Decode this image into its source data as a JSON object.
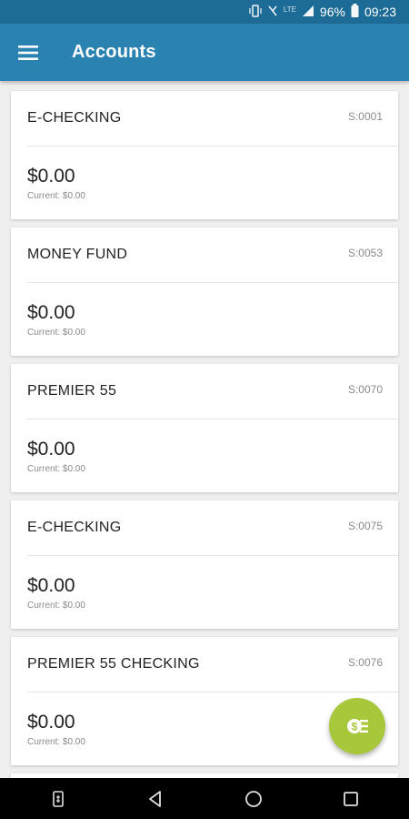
{
  "status_bar": {
    "battery": "96%",
    "time": "09:23",
    "network_label": "LTE",
    "icons": [
      "vibrate-icon",
      "alarm-icon",
      "signal-icon",
      "battery-icon"
    ]
  },
  "app_bar": {
    "title": "Accounts",
    "menu_icon": "hamburger-menu-icon",
    "color": "#2a82b1"
  },
  "accounts": [
    {
      "name": "E-CHECKING",
      "suffix": "S:0001",
      "balance": "$0.00",
      "current": "Current: $0.00"
    },
    {
      "name": "MONEY FUND",
      "suffix": "S:0053",
      "balance": "$0.00",
      "current": "Current: $0.00"
    },
    {
      "name": "PREMIER 55",
      "suffix": "S:0070",
      "balance": "$0.00",
      "current": "Current: $0.00"
    },
    {
      "name": "E-CHECKING",
      "suffix": "S:0075",
      "balance": "$0.00",
      "current": "Current: $0.00"
    },
    {
      "name": "PREMIER 55 CHECKING",
      "suffix": "S:0076",
      "balance": "$0.00",
      "current": "Current: $0.00"
    }
  ],
  "fab": {
    "icon": "transfer-money-icon",
    "color": "#a8c83c"
  },
  "nav_bar": {
    "buttons": [
      "sim-toolkit-icon",
      "back-icon",
      "home-icon",
      "recents-icon"
    ]
  }
}
